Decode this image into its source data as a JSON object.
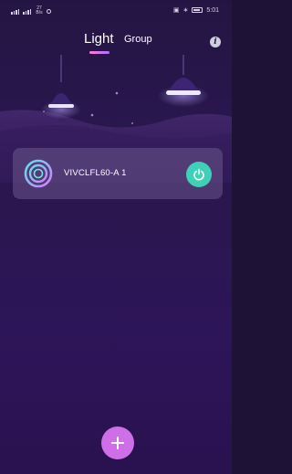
{
  "status_bar": {
    "speed_value": "27",
    "speed_unit": "B/s",
    "time": "5:01"
  },
  "header": {
    "tab_light": "Light",
    "tab_group": "Group",
    "info_icon": "info-icon",
    "accent_gradient": [
      "#ff7ad9",
      "#b26cff"
    ]
  },
  "devices": [
    {
      "name": "VIVCLFL60-A 1",
      "icon": "lamp-ring-icon",
      "power_icon": "power-icon",
      "power_color": "#3fd1b8"
    }
  ],
  "add_button": {
    "icon": "plus-icon",
    "color": "#cf6fe8"
  }
}
